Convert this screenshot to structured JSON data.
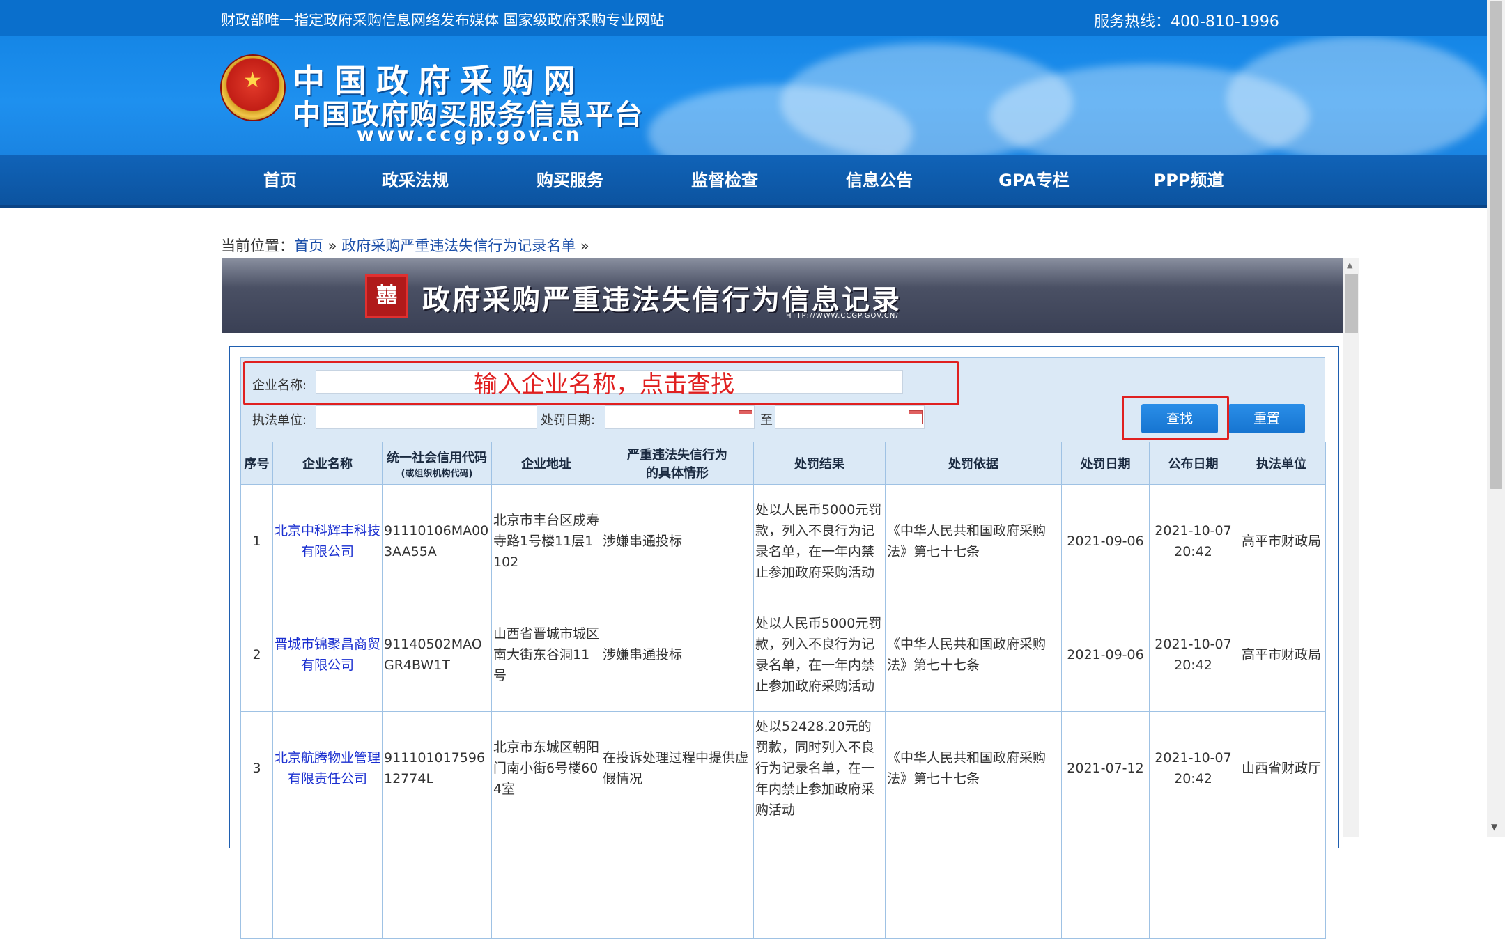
{
  "topbar": {
    "tagline": "财政部唯一指定政府采购信息网络发布媒体 国家级政府采购专业网站",
    "hotline": "服务热线：400-810-1996"
  },
  "header": {
    "logo_title": "中国政府采购网",
    "logo_subtitle": "中国政府购买服务信息平台",
    "logo_url": "www.ccgp.gov.cn",
    "emblem_icon": "national-emblem-icon"
  },
  "nav": {
    "items": [
      "首页",
      "政采法规",
      "购买服务",
      "监督检查",
      "信息公告",
      "GPA专栏",
      "PPP频道"
    ]
  },
  "breadcrumb": {
    "prefix": "当前位置：",
    "home": "首页",
    "sep": " » ",
    "current": "政府采购严重违法失信行为记录名单",
    "tail": " »"
  },
  "panel": {
    "title": "政府采购严重违法失信行为信息记录",
    "url": "HTTP://WWW.CCGP.GOV.CN/",
    "seal_icon": "seal-icon"
  },
  "search": {
    "company_label": "企业名称:",
    "company_value": "",
    "enforcer_label": "执法单位:",
    "enforcer_value": "",
    "date_label": "处罚日期:",
    "date_from": "",
    "date_to_label": "至",
    "date_to": "",
    "search_button": "查找",
    "reset_button": "重置",
    "annotation": "输入企业名称，点击查找"
  },
  "table": {
    "headers": [
      "序号",
      "企业名称",
      "统一社会信用代码",
      "企业地址",
      "严重违法失信行为",
      "处罚结果",
      "处罚依据",
      "处罚日期",
      "公布日期",
      "执法单位"
    ],
    "header_subs": {
      "credit_code": "(或组织机构代码)",
      "behavior": "的具体情形"
    },
    "rows": [
      {
        "no": "1",
        "company": "北京中科辉丰科技有限公司",
        "credit_code": "91110106MA003AA55A",
        "address": "北京市丰台区成寿寺路1号楼11层1102",
        "behavior": "涉嫌串通投标",
        "result": "处以人民币5000元罚款，列入不良行为记录名单，在一年内禁止参加政府采购活动",
        "basis": "《中华人民共和国政府采购法》第七十七条",
        "penalty_date": "2021-09-06",
        "publish_date": "2021-10-07 20:42",
        "enforcer": "高平市财政局"
      },
      {
        "no": "2",
        "company": "晋城市锦聚昌商贸有限公司",
        "credit_code": "91140502MAOGR4BW1T",
        "address": "山西省晋城市城区南大街东谷洞11号",
        "behavior": "涉嫌串通投标",
        "result": "处以人民币5000元罚款，列入不良行为记录名单，在一年内禁止参加政府采购活动",
        "basis": "《中华人民共和国政府采购法》第七十七条",
        "penalty_date": "2021-09-06",
        "publish_date": "2021-10-07 20:42",
        "enforcer": "高平市财政局"
      },
      {
        "no": "3",
        "company": "北京航腾物业管理有限责任公司",
        "credit_code": "91110101759612774L",
        "address": "北京市东城区朝阳门南小街6号楼604室",
        "behavior": "在投诉处理过程中提供虚假情况",
        "result": "处以52428.20元的罚款，同时列入不良行为记录名单，在一年内禁止参加政府采购活动",
        "basis": "《中华人民共和国政府采购法》第七十七条",
        "penalty_date": "2021-07-12",
        "publish_date": "2021-10-07 20:42",
        "enforcer": "山西省财政厅"
      }
    ]
  },
  "colors": {
    "topbar": "#0a6fcc",
    "banner": "#1e90ef",
    "nav": "#0c539f",
    "table_header": "#dbe9f6",
    "annotation": "#e02020",
    "link": "#1a2fd0"
  }
}
